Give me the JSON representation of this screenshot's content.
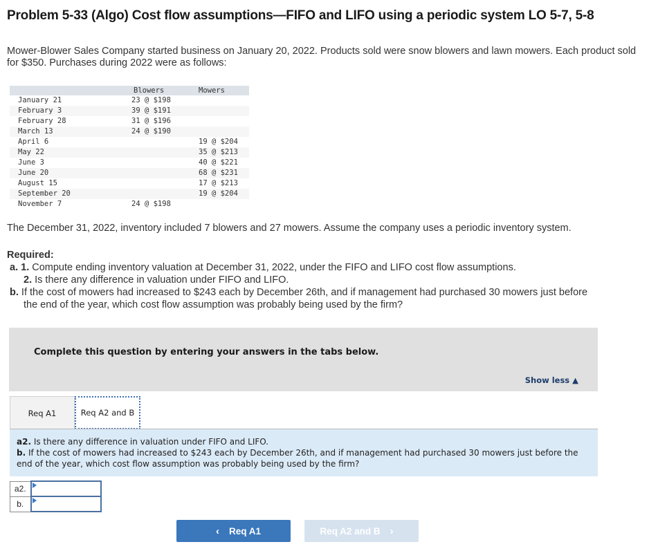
{
  "title": "Problem 5-33 (Algo) Cost flow assumptions—FIFO and LIFO using a periodic system LO 5-7, 5-8",
  "intro": "Mower-Blower Sales Company started business on January 20, 2022. Products sold were snow blowers and lawn mowers. Each product sold for $350. Purchases during 2022 were as follows:",
  "purchases": {
    "headers": [
      "",
      "Blowers",
      "Mowers"
    ],
    "rows": [
      {
        "date": "January 21",
        "blowers": "23 @ $198",
        "mowers": ""
      },
      {
        "date": "February 3",
        "blowers": "39 @ $191",
        "mowers": ""
      },
      {
        "date": "February 28",
        "blowers": "31 @ $196",
        "mowers": ""
      },
      {
        "date": "March 13",
        "blowers": "24 @ $190",
        "mowers": ""
      },
      {
        "date": "April 6",
        "blowers": "",
        "mowers": "19 @ $204"
      },
      {
        "date": "May 22",
        "blowers": "",
        "mowers": "35 @ $213"
      },
      {
        "date": "June 3",
        "blowers": "",
        "mowers": "40 @ $221"
      },
      {
        "date": "June 20",
        "blowers": "",
        "mowers": "68 @ $231"
      },
      {
        "date": "August 15",
        "blowers": "",
        "mowers": "17 @ $213"
      },
      {
        "date": "September 20",
        "blowers": "",
        "mowers": "19 @ $204"
      },
      {
        "date": "November 7",
        "blowers": "24 @ $198",
        "mowers": ""
      }
    ]
  },
  "inventory_note": "The December 31, 2022, inventory included 7 blowers and 27 mowers. Assume the company uses a periodic inventory system.",
  "required": {
    "heading": "Required:",
    "a_label": "a.",
    "a1_num": "1.",
    "a1_text": " Compute ending inventory valuation at December 31, 2022, under the FIFO and LIFO cost flow assumptions.",
    "a2_num": "2.",
    "a2_text": " Is there any difference in valuation under FIFO and LIFO.",
    "b_label": "b.",
    "b_text_line1": " If the cost of mowers had increased to $243 each by December 26th, and if management had purchased 30 mowers just before",
    "b_text_line2": "the end of the year, which cost flow assumption was probably being used by the firm?"
  },
  "instructions": {
    "text": "Complete this question by entering your answers in the tabs below.",
    "show_less": "Show less ▲"
  },
  "tabs": [
    {
      "label": "Req A1",
      "active": false
    },
    {
      "label": "Req A2 and B",
      "active": true
    }
  ],
  "question": {
    "a2_label": "a2.",
    "a2_text": " Is there any difference in valuation under FIFO and LIFO.",
    "b_label": "b.",
    "b_text": " If the cost of mowers had increased to $243 each by December 26th, and if management had purchased 30 mowers just before the end of the year, which cost flow assumption was probably being used by the firm?"
  },
  "answers": [
    {
      "label": "a2.",
      "value": ""
    },
    {
      "label": "b.",
      "value": ""
    }
  ],
  "nav": {
    "prev_label": "Req A1",
    "prev_icon": "‹",
    "next_label": "Req A2 and B",
    "next_icon": "›"
  }
}
